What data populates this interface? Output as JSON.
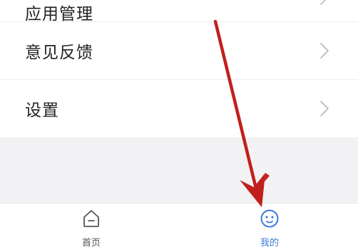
{
  "menu": {
    "items": [
      {
        "label": "应用管理"
      },
      {
        "label": "意见反馈"
      },
      {
        "label": "设置"
      }
    ]
  },
  "tabbar": {
    "tabs": [
      {
        "label": "首页",
        "icon": "home-icon",
        "active": false
      },
      {
        "label": "我的",
        "icon": "smiley-face-icon",
        "active": true
      }
    ]
  },
  "colors": {
    "accent": "#3d7bd6",
    "annotation_arrow": "#c0201d",
    "background_gray": "#f2f2f4"
  }
}
